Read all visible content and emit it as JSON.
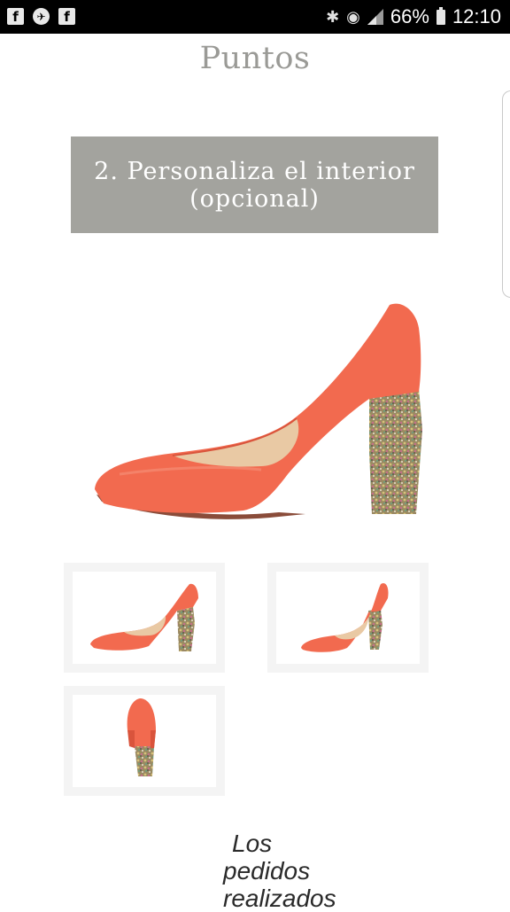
{
  "status_bar": {
    "left_icons": [
      "facebook-icon",
      "pdf-reader-icon",
      "facebook-icon"
    ],
    "battery_percent": "66%",
    "time": "12:10"
  },
  "page": {
    "title": "Puntos",
    "step_heading_line1": "2. Personaliza el interior",
    "step_heading_line2": "(opcional)"
  },
  "gallery": {
    "main_image": "coral-pump-glitter-heel-side-view",
    "thumbnails": [
      "coral-pump-side-view",
      "coral-pump-three-quarter-view",
      "coral-pump-back-view"
    ]
  },
  "footer": {
    "line1": "Los",
    "line2": "pedidos",
    "line3": "realizados"
  },
  "colors": {
    "shoe": "#f26a4f",
    "heading_box": "#a3a39e",
    "title": "#9a9a96"
  }
}
